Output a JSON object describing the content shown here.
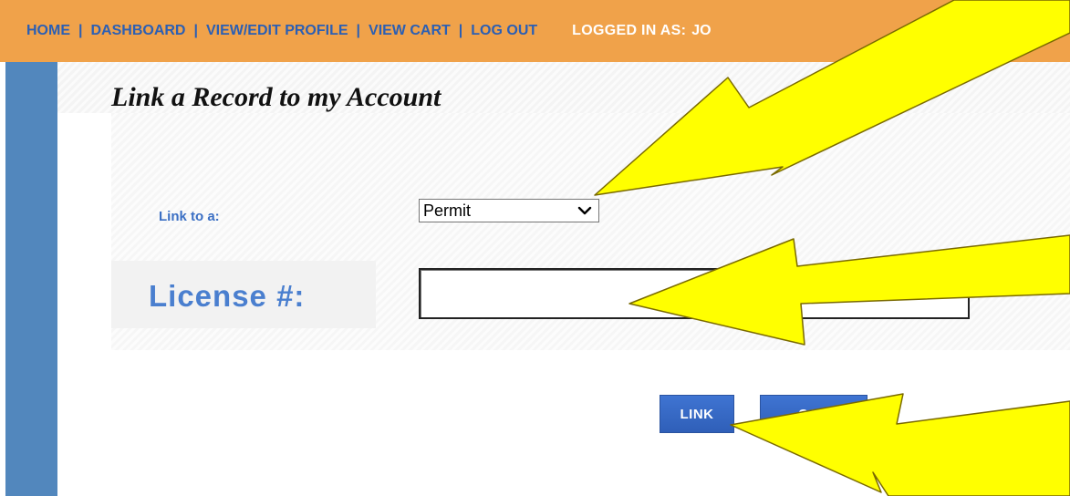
{
  "nav": {
    "items": [
      {
        "label": "HOME"
      },
      {
        "label": "DASHBOARD"
      },
      {
        "label": "VIEW/EDIT PROFILE"
      },
      {
        "label": "VIEW CART"
      },
      {
        "label": "LOG OUT"
      }
    ],
    "separator": "|",
    "logged_in_label": "LOGGED IN AS:",
    "logged_in_user": "JO"
  },
  "main": {
    "title": "Link a Record to my Account",
    "link_to_label": "Link to a:",
    "link_to_selected": "Permit",
    "license_label": "License #:",
    "license_value": "",
    "link_button": "LINK",
    "cancel_button": "CAN"
  },
  "colors": {
    "nav_bg": "#f0a24a",
    "nav_link": "#2b5fb4",
    "sidebar": "#5287bd",
    "button": "#3568c6",
    "arrow_fill": "#ffff00"
  },
  "icons": {
    "select_chevron": "chevron-down-icon"
  }
}
